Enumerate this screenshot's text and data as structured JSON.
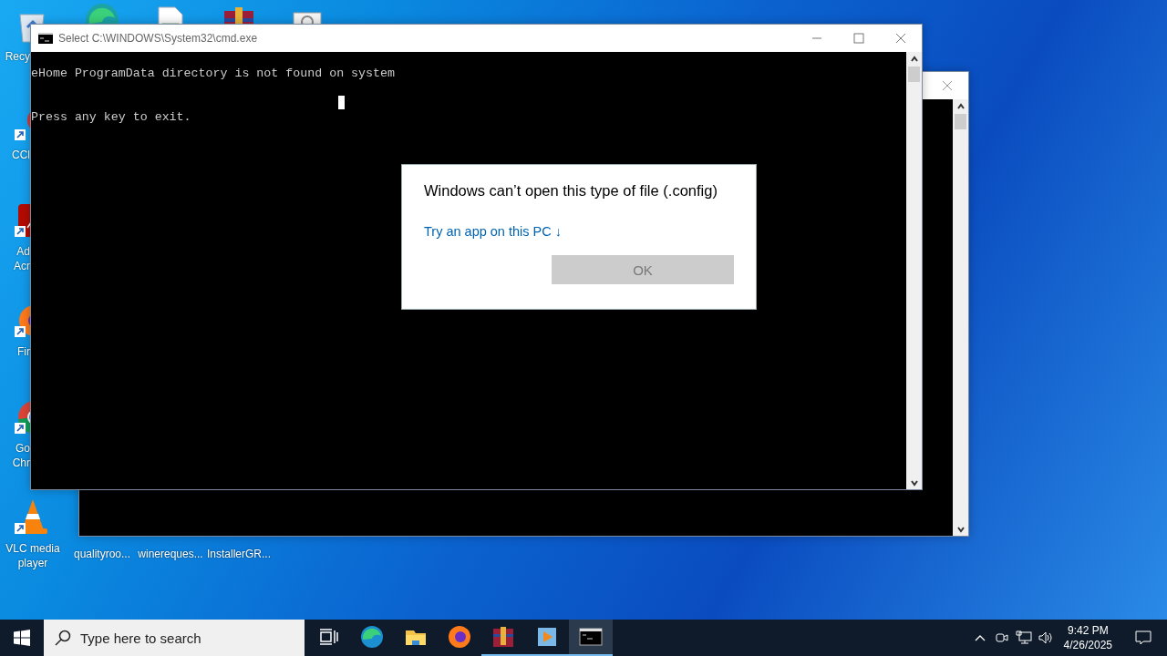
{
  "desktop_icons": [
    {
      "kind": "recycle-bin",
      "label": [
        "Recy"
      ]
    },
    {
      "kind": "edge"
    },
    {
      "kind": "document"
    },
    {
      "kind": "winrar"
    },
    {
      "kind": "settings-file"
    },
    {
      "kind": "ccleaner",
      "label": [
        "CCl"
      ]
    },
    {
      "kind": "acrobat",
      "label": [
        "Ad",
        "Acr"
      ]
    },
    {
      "kind": "firefox",
      "label": [
        "Fir"
      ]
    },
    {
      "kind": "chrome",
      "label": [
        "Go",
        "Chr"
      ]
    },
    {
      "kind": "vlc",
      "label": [
        "VLC media",
        "player"
      ]
    },
    {
      "kind": "file",
      "label": [
        "qualityroo..."
      ]
    },
    {
      "kind": "file",
      "label": [
        "winereques..."
      ]
    },
    {
      "kind": "file",
      "label": [
        "InstallerGR..."
      ]
    }
  ],
  "back_window": {
    "kind": "console"
  },
  "cmd_window": {
    "title": "Select C:\\WINDOWS\\System32\\cmd.exe",
    "output": "eHome ProgramData directory is not found on system\n\nPress any key to exit.",
    "cursor": true
  },
  "dialog": {
    "message": "Windows can’t open this type of file (.config)",
    "link": "Try an app on this PC ↓",
    "ok_button": {
      "label": "OK",
      "disabled": true
    }
  },
  "taskbar": {
    "search": {
      "placeholder": "Type here to search"
    },
    "apps": [
      {
        "kind": "task-view",
        "open": false,
        "selected": false
      },
      {
        "kind": "edge",
        "open": false,
        "selected": false
      },
      {
        "kind": "explorer",
        "open": false,
        "selected": false
      },
      {
        "kind": "firefox",
        "open": false,
        "selected": false
      },
      {
        "kind": "winrar",
        "open": true,
        "selected": false
      },
      {
        "kind": "media-player",
        "open": true,
        "selected": false
      },
      {
        "kind": "cmd",
        "open": true,
        "selected": true
      }
    ],
    "clock": {
      "time": "9:42 PM",
      "date": "4/26/2025"
    }
  }
}
